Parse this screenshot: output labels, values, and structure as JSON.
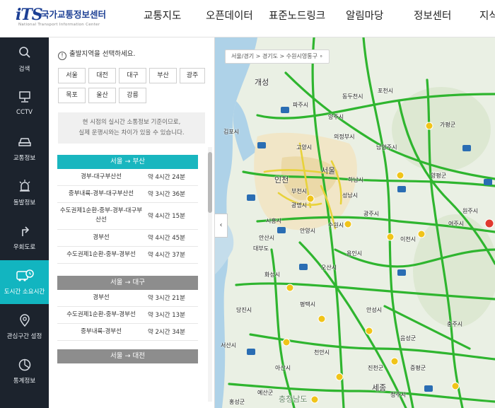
{
  "header": {
    "logo_mark": "iTS",
    "logo_title": "국가교통정보센터",
    "logo_sub": "National Transport Information Center",
    "nav": [
      "교통지도",
      "오픈데이터",
      "표준노드링크",
      "알림마당",
      "정보센터",
      "지식"
    ]
  },
  "sidebar": {
    "items": [
      {
        "label": "검색",
        "icon": "search-icon"
      },
      {
        "label": "CCTV",
        "icon": "cctv-icon"
      },
      {
        "label": "교통정보",
        "icon": "car-icon"
      },
      {
        "label": "돌발정보",
        "icon": "alert-light-icon"
      },
      {
        "label": "우회도로",
        "icon": "detour-icon"
      },
      {
        "label": "도시간 소요시간",
        "icon": "bus-clock-icon"
      },
      {
        "label": "관심구간 설정",
        "icon": "pin-icon"
      },
      {
        "label": "통계정보",
        "icon": "chart-icon"
      }
    ],
    "active_index": 5
  },
  "panel": {
    "pick_title": "출발지역을 선택하세요.",
    "cities": [
      "서울",
      "대전",
      "대구",
      "부산",
      "광주",
      "목포",
      "울산",
      "강릉"
    ],
    "notice_line1": "현 시점의 실시간 소통정보 기준이므로,",
    "notice_line2": "실제 운행시와는 차이가 있을 수 있습니다.",
    "groups": [
      {
        "title": "서울 → 부산",
        "rows": [
          {
            "name": "경부-대구부산선",
            "time": "약 4시간 24분"
          },
          {
            "name": "중부내륙-경부-대구부산선",
            "time": "약 3시간 36분"
          },
          {
            "name": "수도권제1순환-중부-경부-대구부산선",
            "time": "약 4시간 15분"
          },
          {
            "name": "경부선",
            "time": "약 4시간 45분"
          },
          {
            "name": "수도권제1순환-중부-경부선",
            "time": "약 4시간 37분"
          }
        ]
      },
      {
        "title": "서울 → 대구",
        "rows": [
          {
            "name": "경부선",
            "time": "약 3시간 21분"
          },
          {
            "name": "수도권제1순환-중부-경부선",
            "time": "약 3시간 13분"
          },
          {
            "name": "중부내륙-경부선",
            "time": "약 2시간 34분"
          }
        ]
      },
      {
        "title": "서울 → 대전",
        "rows": []
      }
    ]
  },
  "map": {
    "breadcrumb": "서울/경기 > 경기도 > 수원시영통구 ∘",
    "collapse_label": "‹",
    "labels": [
      "개성",
      "파주시",
      "동두천시",
      "양주시",
      "포천시",
      "가평군",
      "김포시",
      "고양시",
      "의정부시",
      "남양주시",
      "서울",
      "인천",
      "부천시",
      "하남시",
      "광명시",
      "성남시",
      "양평군",
      "시흥시",
      "안양시",
      "광주시",
      "수원시",
      "용인시",
      "이천시",
      "여주시",
      "안산시",
      "화성시",
      "평택시",
      "안성시",
      "오산시",
      "음성군",
      "아산시",
      "천안시",
      "진천군",
      "충주시",
      "원주시",
      "당진시",
      "대부도",
      "서산시",
      "예산군",
      "증평군",
      "청주시",
      "세종",
      "홍성군",
      "충청남도"
    ],
    "colors": {
      "road_green": "#2fb52f",
      "road_yellow": "#e8d23a",
      "land": "#eaf0e4",
      "water": "#aed2e8",
      "city": "#f3e8c9"
    }
  }
}
